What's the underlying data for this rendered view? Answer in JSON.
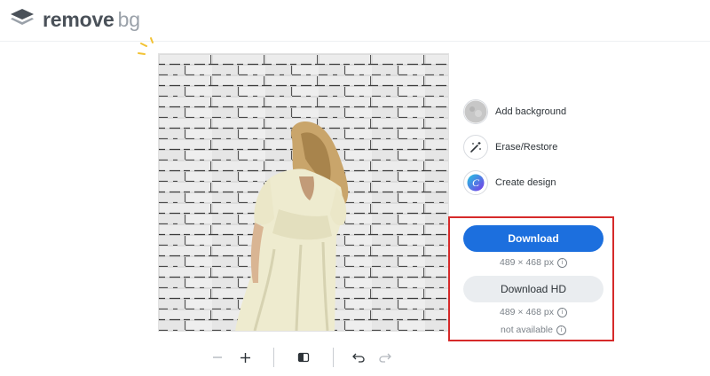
{
  "header": {
    "logo_icon": "layers-icon",
    "logo_remove": "remove",
    "logo_bg": "bg"
  },
  "editor": {
    "image_alt": "Woman in cream dress standing in front of white brick wall",
    "tools": [
      {
        "label": "Add background",
        "icon": "texture-thumbnail-icon"
      },
      {
        "label": "Erase/Restore",
        "icon": "magic-wand-icon"
      },
      {
        "label": "Create design",
        "icon": "canva-icon"
      }
    ],
    "download": {
      "label": "Download",
      "size": "489 × 468 px"
    },
    "download_hd": {
      "label": "Download HD",
      "size": "489 × 468 px",
      "status": "not available"
    },
    "info_icon": "i",
    "toolbar": {
      "zoom_out": "zoom-out-icon",
      "zoom_in": "zoom-in-icon",
      "compare": "compare-icon",
      "undo": "undo-icon",
      "redo": "redo-icon"
    }
  },
  "colors": {
    "primary": "#1c6fde",
    "highlight": "#d62a2a",
    "secondary_button": "#eaedf0",
    "logo_dark": "#4a5159",
    "logo_light": "#9aa1a9"
  }
}
